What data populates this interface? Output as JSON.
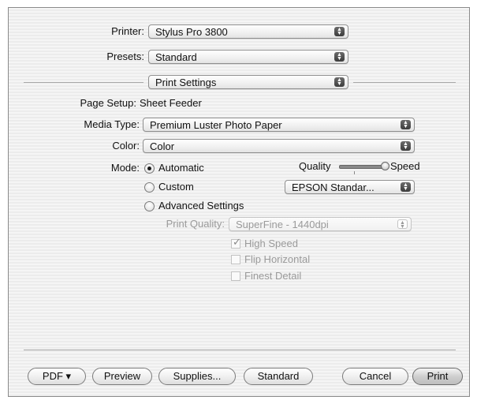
{
  "printer": {
    "label": "Printer:",
    "value": "Stylus Pro 3800"
  },
  "presets": {
    "label": "Presets:",
    "value": "Standard"
  },
  "panel": {
    "value": "Print Settings"
  },
  "page_setup": {
    "label": "Page Setup:",
    "value": "Sheet Feeder"
  },
  "media_type": {
    "label": "Media Type:",
    "value": "Premium Luster Photo Paper"
  },
  "color": {
    "label": "Color:",
    "value": "Color"
  },
  "mode": {
    "label": "Mode:",
    "automatic": "Automatic",
    "custom": "Custom",
    "advanced": "Advanced Settings",
    "selected": "automatic"
  },
  "quality_slider": {
    "left_label": "Quality",
    "right_label": "Speed",
    "position": 1.0
  },
  "custom_setting": {
    "value": "EPSON Standar..."
  },
  "advanced": {
    "print_quality_label": "Print Quality:",
    "print_quality_value": "SuperFine - 1440dpi",
    "high_speed": "High Speed",
    "high_speed_checked": true,
    "flip_horizontal": "Flip Horizontal",
    "flip_horizontal_checked": false,
    "finest_detail": "Finest Detail",
    "finest_detail_checked": false
  },
  "buttons": {
    "pdf": "PDF ▾",
    "preview": "Preview",
    "supplies": "Supplies...",
    "standard": "Standard",
    "cancel": "Cancel",
    "print": "Print"
  }
}
